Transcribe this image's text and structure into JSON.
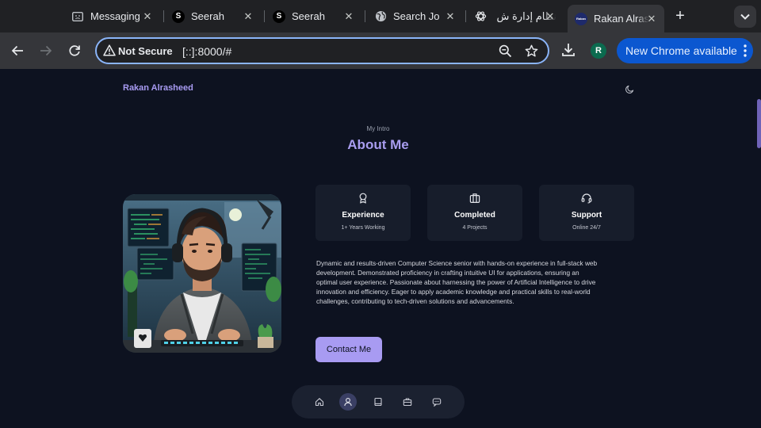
{
  "browser": {
    "tabs": [
      {
        "title": "Messaging",
        "favicon": "message-icon"
      },
      {
        "title": "Seerah",
        "favicon": "S"
      },
      {
        "title": "Seerah",
        "favicon": "S"
      },
      {
        "title": "Search Jo",
        "favicon": "globe-icon"
      },
      {
        "title": "نظام إدارة ش",
        "favicon": "openai-icon"
      },
      {
        "title": "Rakan Alrasheed",
        "favicon": "Rakan",
        "active": true
      }
    ],
    "address": {
      "security_label": "Not Secure",
      "url": "[::]:8000/#"
    },
    "profile_initial": "R",
    "update_label": "New Chrome available"
  },
  "page": {
    "brand": "Rakan Alrasheed",
    "intro_label": "My Intro",
    "heading": "About Me",
    "cards": [
      {
        "icon": "award-icon",
        "title": "Experience",
        "subtitle": "1+ Years Working"
      },
      {
        "icon": "briefcase-icon",
        "title": "Completed",
        "subtitle": "4 Projects"
      },
      {
        "icon": "headset-icon",
        "title": "Support",
        "subtitle": "Online 24/7"
      }
    ],
    "description": "Dynamic and results-driven Computer Science senior with hands-on experience in full-stack web development. Demonstrated proficiency in crafting intuitive UI for applications, ensuring an optimal user experience. Passionate about harnessing the power of Artificial Intelligence to drive innovation and efficiency. Eager to apply academic knowledge and practical skills to real-world challenges, contributing to tech-driven solutions and advancements.",
    "contact_label": "Contact Me",
    "dock_items": [
      "home-icon",
      "user-icon",
      "book-icon",
      "briefcase-icon",
      "chat-icon"
    ],
    "dock_active_index": 1
  },
  "colors": {
    "accent": "#a89bf2",
    "page_bg": "#0d1220",
    "card_bg": "#171d2b",
    "chrome_update": "#0b57d0"
  }
}
